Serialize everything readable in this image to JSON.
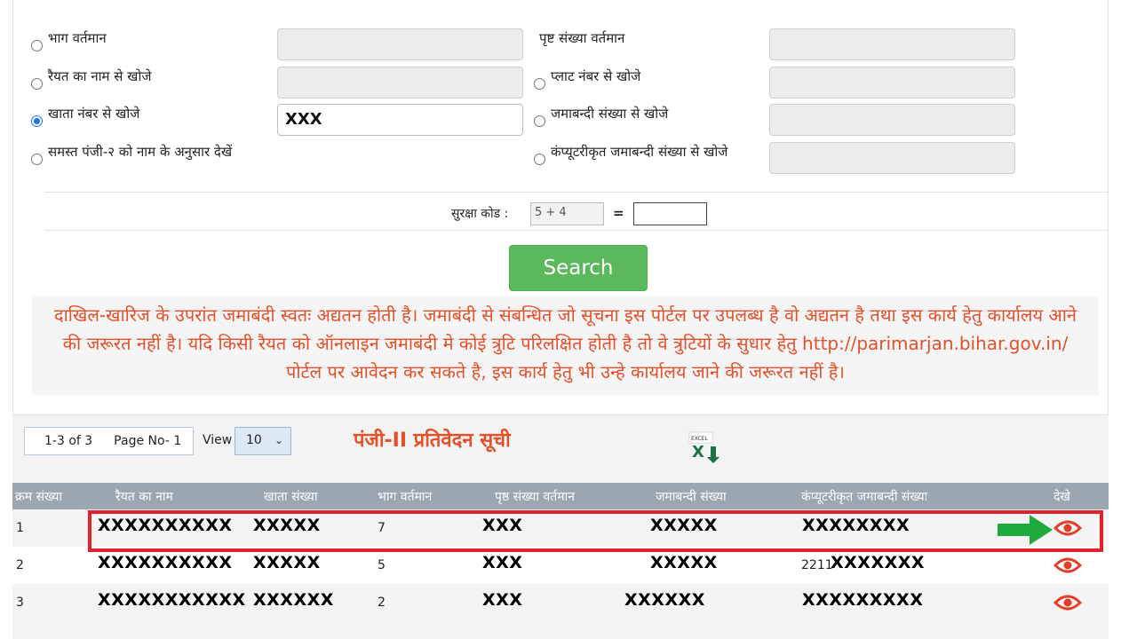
{
  "form": {
    "options": [
      {
        "label": "भाग वर्तमान",
        "checked": false,
        "value": ""
      },
      {
        "label": "रैयत का नाम से खोजे",
        "checked": false,
        "value": ""
      },
      {
        "label": "खाता नंबर से खोजे",
        "checked": true,
        "value": "XXX"
      },
      {
        "label": "समस्त पंजी-२ को नाम के अनुसार देखें",
        "checked": false,
        "value": ""
      },
      {
        "label": "पृष्ट संख्या वर्तमान",
        "checked": false,
        "value": ""
      },
      {
        "label": "प्लाट नंबर से खोजे",
        "checked": false,
        "value": ""
      },
      {
        "label": "जमाबन्दी संख्या से खोजे",
        "checked": false,
        "value": ""
      },
      {
        "label": "कंप्यूटरीकृत जमाबन्दी संख्या से खोजे",
        "checked": false,
        "value": ""
      }
    ],
    "captcha_label": "सुरक्षा कोड :",
    "captcha_value": "5 + 4",
    "equals": "=",
    "captcha_answer": "",
    "search_label": "Search"
  },
  "notice": "दाखिल-खारिज के उपरांत जमाबंदी स्वतः अद्यतन होती है। जमाबंदी से संबन्धित जो सूचना इस पोर्टल पर उपलब्ध है वो अद्यतन है तथा इस कार्य हेतु कार्यालय आने की जरूरत नहीं है। यदि किसी रैयत को ऑनलाइन जमाबंदी मे कोई त्रुटि परिलक्षित होती है तो वे त्रुटियों के सुधार हेतु http://parimarjan.bihar.gov.in/ पोर्टल पर आवेदन कर सकते है, इस कार्य हेतु भी उन्हे कार्यालय जाने की जरूरत नहीं है।",
  "results": {
    "range": "1-3 of 3",
    "page": "Page No- 1",
    "view_label": "View",
    "view_value": "10",
    "title": "पंजी-II प्रतिवेदन सूची",
    "excel_label": "EXCEL",
    "columns": [
      "क्रम संख्या",
      "रैयत का नाम",
      "खाता संख्या",
      "भाग वर्तमान",
      "पृष्ठ संख्या वर्तमान",
      "जमाबन्दी संख्या",
      "कंप्यूटरीकृत जमाबन्दी संख्या",
      "देखे"
    ],
    "rows": [
      {
        "sno": "1",
        "name": "XXXXXXXXXX",
        "khata": "XXXXX",
        "bhag": "7",
        "prishth": "XXX",
        "jamabandi": "XXXXX",
        "computer": "XXXXXXXX",
        "computer_prefix": ""
      },
      {
        "sno": "2",
        "name": "XXXXXXXXXX",
        "khata": "XXXXX",
        "bhag": "5",
        "prishth": "XXX",
        "jamabandi": "XXXXX",
        "computer": "XXXXXXX",
        "computer_prefix": "2211"
      },
      {
        "sno": "3",
        "name": "XXXXXXXXXXX",
        "khata": "XXXXXX",
        "bhag": "2",
        "prishth": "XXX",
        "jamabandi": "XXXXXX",
        "computer": "XXXXXXXXX",
        "computer_prefix": ""
      }
    ]
  },
  "colors": {
    "accent_red": "#e4502a",
    "button_green": "#5cb85c",
    "highlight": "#e0202a",
    "arrow_green": "#1faa3c"
  }
}
